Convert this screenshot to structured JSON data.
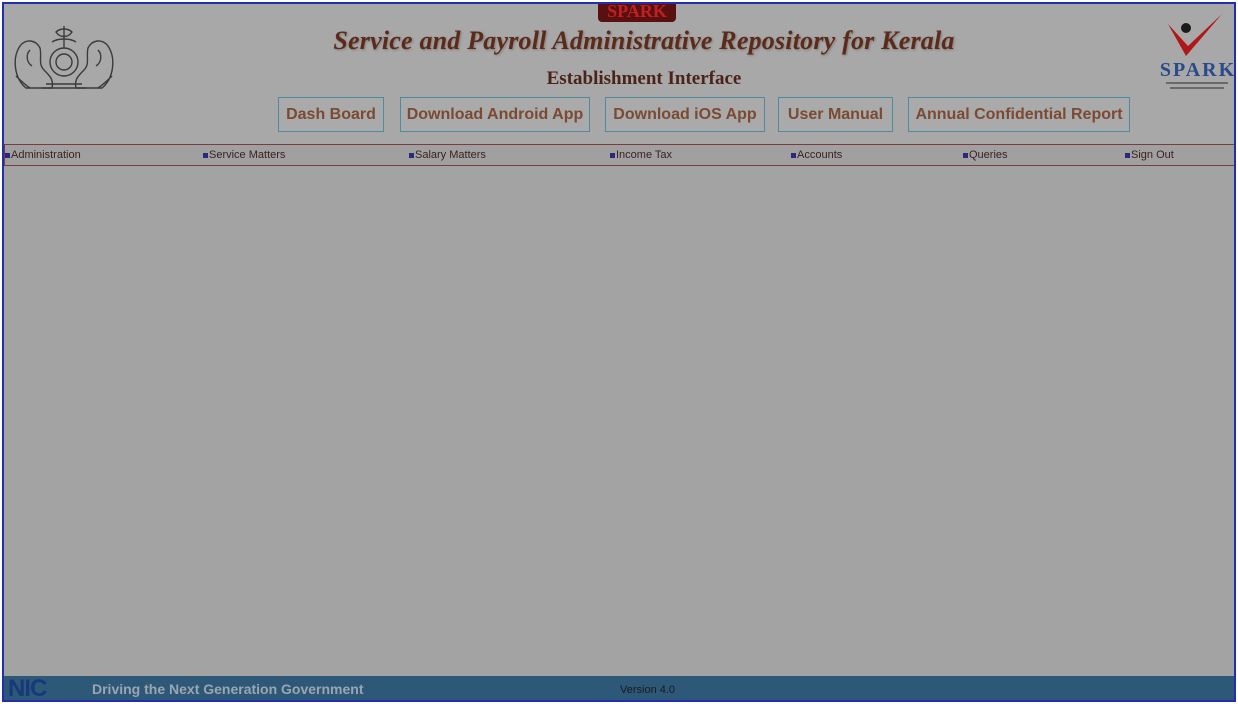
{
  "header": {
    "logo_top_text": "SPARK",
    "title": "Service and Payroll Administrative Repository for Kerala",
    "subtitle": "Establishment Interface",
    "spark_logo_text": "SPARK"
  },
  "nav_buttons": {
    "dashboard": "Dash Board",
    "android": "Download Android App",
    "ios": "Download iOS App",
    "manual": "User Manual",
    "acr": "Annual Confidential Report"
  },
  "menu": {
    "administration": "Administration",
    "service_matters": "Service Matters",
    "salary_matters": "Salary Matters",
    "income_tax": "Income Tax",
    "accounts": "Accounts",
    "queries": "Queries",
    "sign_out": "Sign Out"
  },
  "footer": {
    "nic": "NIC",
    "tagline": "Driving the Next Generation Government",
    "version": "Version 4.0"
  },
  "colors": {
    "overlay": "#a3a3a3",
    "border": "#1f2fb0",
    "footer": "#2e5878",
    "title": "#5b2a1a",
    "spark_red": "#b01818"
  }
}
